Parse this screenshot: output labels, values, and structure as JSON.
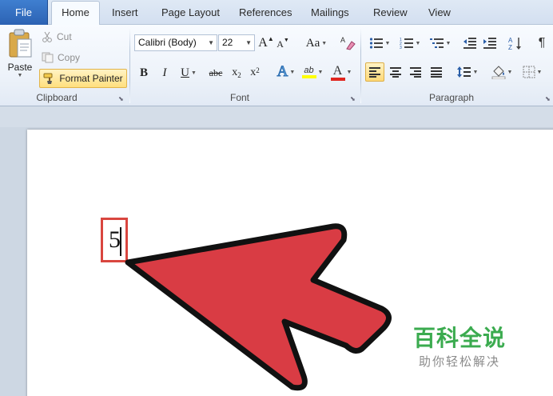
{
  "tabs": [
    {
      "label": "File"
    },
    {
      "label": "Home"
    },
    {
      "label": "Insert"
    },
    {
      "label": "Page Layout"
    },
    {
      "label": "References"
    },
    {
      "label": "Mailings"
    },
    {
      "label": "Review"
    },
    {
      "label": "View"
    }
  ],
  "clipboard": {
    "paste_label": "Paste",
    "cut_label": "Cut",
    "copy_label": "Copy",
    "format_painter_label": "Format Painter",
    "group_label": "Clipboard"
  },
  "font": {
    "font_name": "Calibri (Body)",
    "font_size": "22",
    "grow_glyph": "A",
    "shrink_glyph": "A",
    "case_glyph": "Aa",
    "bold_glyph": "B",
    "italic_glyph": "I",
    "underline_glyph": "U",
    "strike_glyph": "abc",
    "subscript_glyph": "x",
    "subscript_mark": "2",
    "superscript_glyph": "x",
    "superscript_mark": "2",
    "effects_glyph": "A",
    "highlight_glyph": "ab",
    "color_glyph": "A",
    "group_label": "Font",
    "highlight_color": "#ffff00",
    "font_color": "#e0261f"
  },
  "paragraph": {
    "group_label": "Paragraph",
    "pilcrow_glyph": "¶"
  },
  "document": {
    "typed_text": "5"
  },
  "watermark": {
    "title": "百科全说",
    "subtitle": "助你轻松解决"
  },
  "colors": {
    "annotation_red": "#d9463f",
    "file_tab_blue": "#2c62b3",
    "watermark_green": "#3bab4f"
  }
}
